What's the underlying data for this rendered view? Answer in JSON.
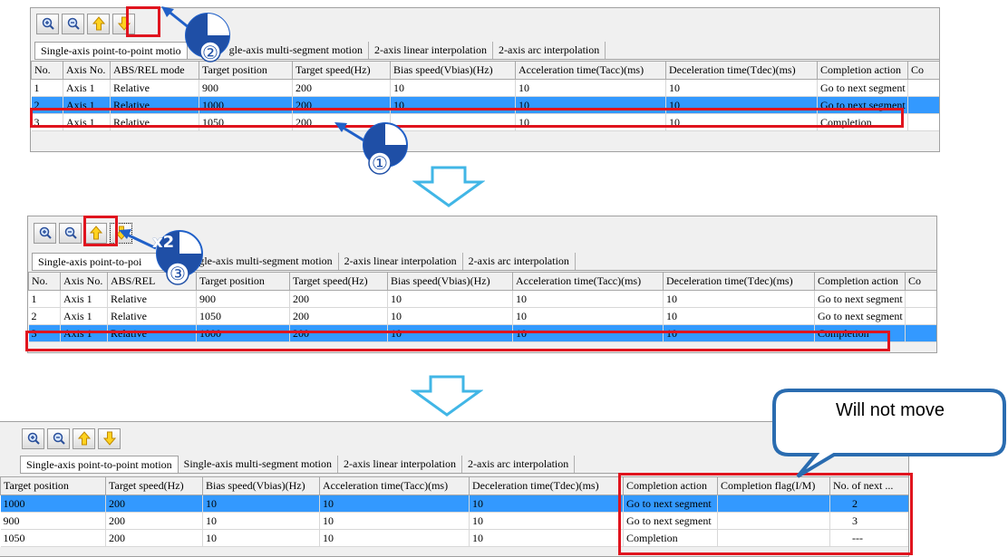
{
  "toolbar": {
    "buttons": [
      {
        "icon": "zoom-in-icon"
      },
      {
        "icon": "zoom-out-icon"
      },
      {
        "icon": "move-up-arrow-icon"
      },
      {
        "icon": "move-down-arrow-icon"
      }
    ]
  },
  "tabs": [
    "Single-axis point-to-point motion",
    "Single-axis multi-segment motion",
    "2-axis linear interpolation",
    "2-axis arc interpolation"
  ],
  "panel1": {
    "tab0_label": "Single-axis point-to-point motio",
    "tab1_label": "gle-axis multi-segment motion",
    "headers": [
      "No.",
      "Axis No.",
      "ABS/REL mode",
      "Target position",
      "Target speed(Hz)",
      "Bias speed(Vbias)(Hz)",
      "Acceleration time(Tacc)(ms)",
      "Deceleration time(Tdec)(ms)",
      "Completion action",
      "Co"
    ],
    "rows": [
      [
        "1",
        "Axis 1",
        "Relative",
        "900",
        "200",
        "10",
        "10",
        "10",
        "Go to next segment",
        ""
      ],
      [
        "2",
        "Axis 1",
        "Relative",
        "1000",
        "200",
        "10",
        "10",
        "10",
        "Go to next segment",
        ""
      ],
      [
        "3",
        "Axis 1",
        "Relative",
        "1050",
        "200",
        "",
        "10",
        "10",
        "Completion",
        ""
      ]
    ],
    "selected_row": 2
  },
  "panel2": {
    "tab0_label": "Single-axis point-to-poi",
    "headers": [
      "No.",
      "Axis No.",
      "ABS/REL",
      "Target position",
      "Target speed(Hz)",
      "Bias speed(Vbias)(Hz)",
      "Acceleration time(Tacc)(ms)",
      "Deceleration time(Tdec)(ms)",
      "Completion action",
      "Co"
    ],
    "rows": [
      [
        "1",
        "Axis 1",
        "Relative",
        "900",
        "200",
        "10",
        "10",
        "10",
        "Go to next segment",
        ""
      ],
      [
        "2",
        "Axis 1",
        "Relative",
        "1050",
        "200",
        "10",
        "10",
        "10",
        "Go to next segment",
        ""
      ],
      [
        "3",
        "Axis 1",
        "Relative",
        "1000",
        "200",
        "10",
        "10",
        "10",
        "Completion",
        ""
      ]
    ],
    "selected_row": 3
  },
  "panel3": {
    "headers": [
      "Target position",
      "Target speed(Hz)",
      "Bias speed(Vbias)(Hz)",
      "Acceleration time(Tacc)(ms)",
      "Deceleration time(Tdec)(ms)",
      "Completion action",
      "Completion flag(I/M)",
      "No. of next ..."
    ],
    "rows": [
      [
        "1000",
        "200",
        "10",
        "10",
        "10",
        "Go to next segment",
        "",
        "2"
      ],
      [
        "900",
        "200",
        "10",
        "10",
        "10",
        "Go to next segment",
        "",
        "3"
      ],
      [
        "1050",
        "200",
        "10",
        "10",
        "10",
        "Completion",
        "",
        "---"
      ]
    ],
    "selected_row": 1
  },
  "annotations": {
    "step1": "①",
    "step2": "②",
    "step3": "③",
    "times2": "x2",
    "callout_text": "Will not move"
  },
  "colors": {
    "highlight_red": "#e0141e",
    "selection_blue": "#3399ff",
    "flow_arrow": "#41b6e6",
    "pointer_arrow": "#2060c8",
    "callout_border": "#2a6cb0"
  }
}
